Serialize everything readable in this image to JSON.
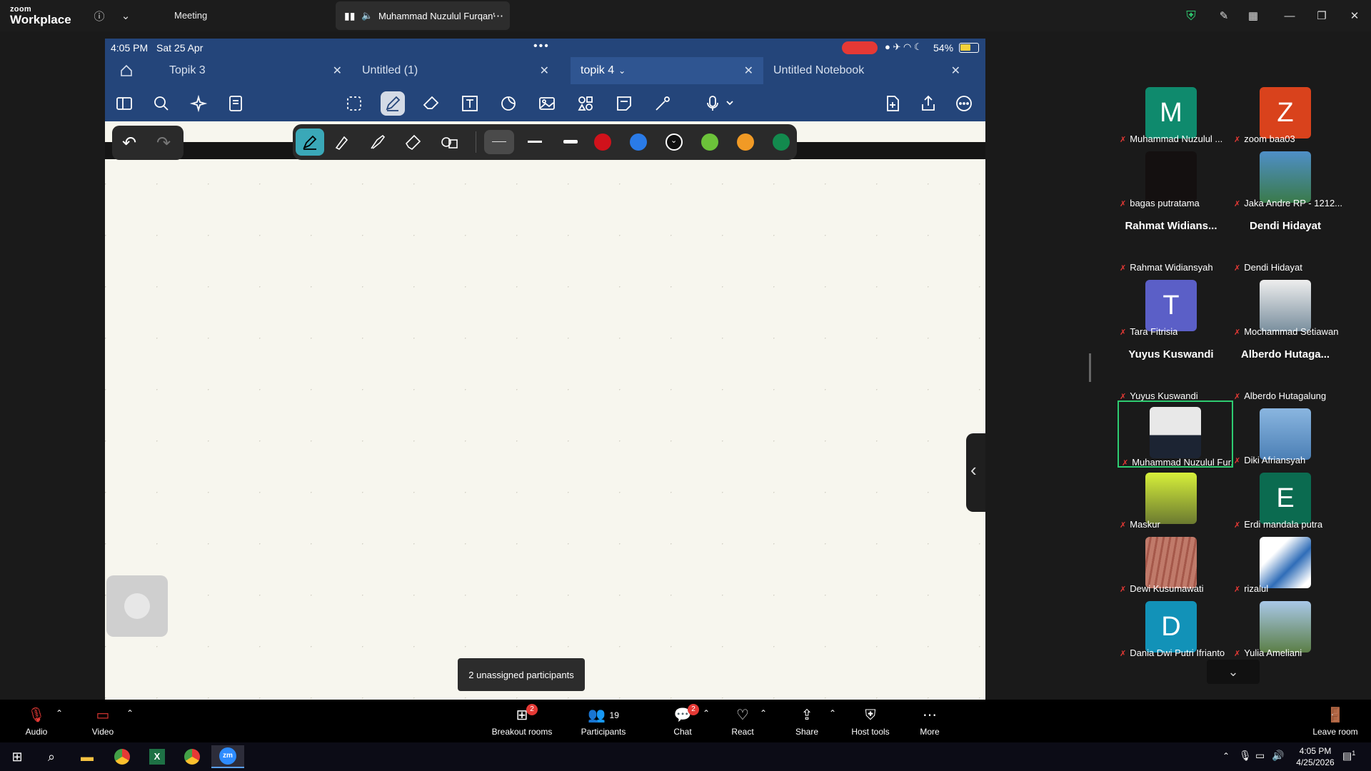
{
  "zoom": {
    "logo_line1": "zoom",
    "logo_line2": "Workplace",
    "meeting_label": "Meeting",
    "share_title": "Muhammad Nuzulul Furqan'"
  },
  "ipad": {
    "time": "4:05 PM",
    "date": "Sat 25 Apr",
    "battery": "54%",
    "tabs": [
      {
        "label": "Topik 3"
      },
      {
        "label": "Untitled (1)"
      },
      {
        "label": "topik 4"
      },
      {
        "label": "Untitled Notebook"
      }
    ],
    "pen_colors": [
      "#d0121b",
      "#2a7be8",
      "#111111",
      "#6cc23a",
      "#f19a25",
      "#138a4e"
    ]
  },
  "tooltip": "2 unassigned participants",
  "gallery": [
    {
      "name": "Muhammad Nuzulul ...",
      "letter": "M",
      "color": "#0f8a6d"
    },
    {
      "name": "zoom baa03",
      "letter": "Z",
      "color": "#d9421c"
    },
    {
      "name": "bagas putratama",
      "letter": "",
      "color": "#141010"
    },
    {
      "name": "Jaka Andre RP - 1212...",
      "letter": "",
      "color": "#3a7a4a"
    },
    {
      "name": "Rahmat Widiansyah",
      "big": "Rahmat  Widians..."
    },
    {
      "name": "Dendi Hidayat",
      "big": "Dendi Hidayat"
    },
    {
      "name": "Tara Fitrisia",
      "letter": "T",
      "color": "#5b5fc7"
    },
    {
      "name": "Mochammad Setiawan",
      "letter": "",
      "color": "#7a8f9e"
    },
    {
      "name": "Yuyus Kuswandi",
      "big": "Yuyus Kuswandi"
    },
    {
      "name": "Alberdo Hutagalung",
      "big": "Alberdo  Hutaga..."
    },
    {
      "name": "Muhammad Nuzulul Fur...",
      "letter": "",
      "color": "#d9d9d9"
    },
    {
      "name": "Diki Afriansyah",
      "letter": "",
      "color": "#4b7fb5"
    },
    {
      "name": "Maskur",
      "letter": "",
      "color": "#6b7a30"
    },
    {
      "name": "Erdi mandala putra",
      "letter": "E",
      "color": "#0b6b50"
    },
    {
      "name": "Dewi Kusumawati",
      "letter": "",
      "color": "#b9685a"
    },
    {
      "name": "rizalul",
      "letter": "",
      "color": "#2f6db8"
    },
    {
      "name": "Dania Dwi Putri Ifrianto",
      "letter": "D",
      "color": "#1292b8"
    },
    {
      "name": "Yulia Ameliani",
      "letter": "",
      "color": "#7aa2c8"
    }
  ],
  "bottombar": {
    "audio": "Audio",
    "video": "Video",
    "breakout": "Breakout rooms",
    "breakout_badge": "2",
    "participants": "Participants",
    "participants_count": "19",
    "chat": "Chat",
    "chat_badge": "2",
    "react": "React",
    "share": "Share",
    "hosttools": "Host tools",
    "more": "More",
    "leave": "Leave room"
  },
  "taskbar": {
    "time": "4:05 PM",
    "date": "4/25/2026",
    "notif_count": "1"
  }
}
